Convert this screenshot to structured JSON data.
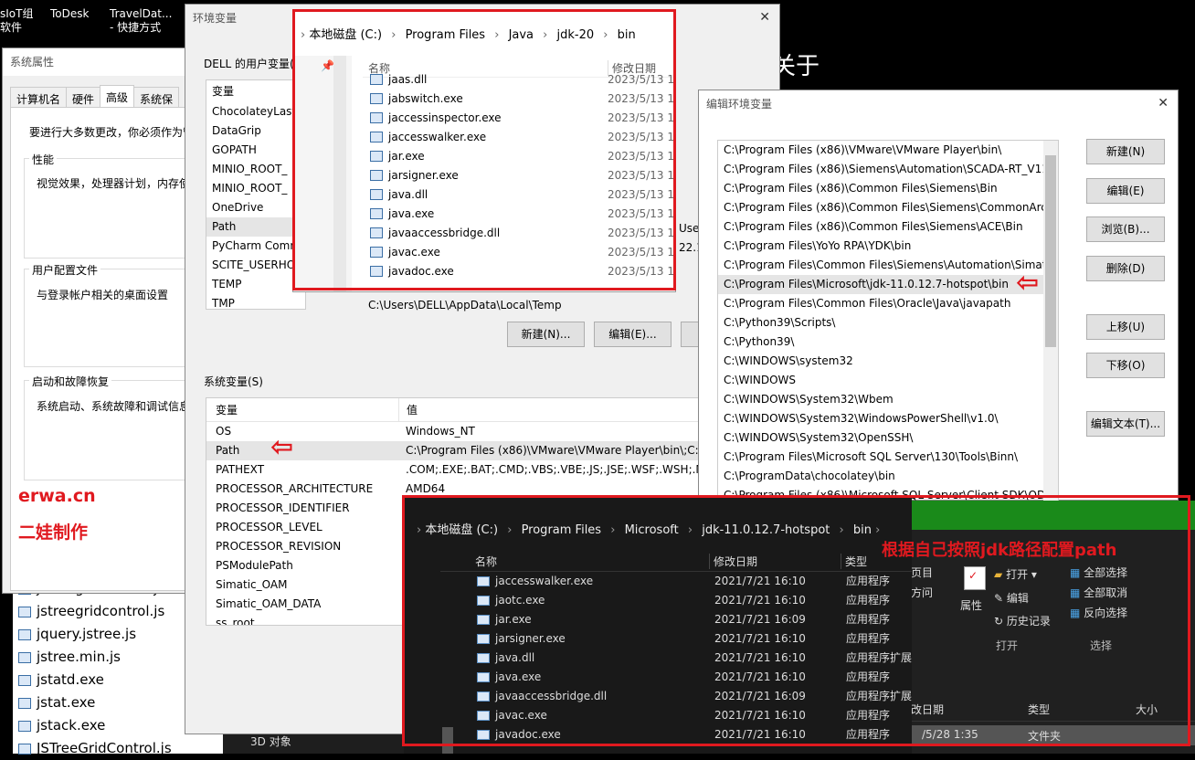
{
  "desktop": {
    "icons": [
      {
        "label": "sIoT组\n软件"
      },
      {
        "label": "ToDesk"
      },
      {
        "label": "TravelDat...\n- 快捷方式"
      }
    ],
    "big_text": "关于",
    "files_left": [
      "jstreegridcontrol.js",
      "jstreegridcontrol.js",
      "jquery.jstree.js",
      "jstree.min.js",
      "jstatd.exe",
      "jstat.exe",
      "jstack.exe",
      "JSTreeGridControl.js"
    ],
    "bottom_item": "3D 对象"
  },
  "sysprops": {
    "title": "系统属性",
    "tabs": [
      "计算机名",
      "硬件",
      "高级",
      "系统保"
    ],
    "admin_note": "要进行大多数更改，你必须作为管",
    "perf_label": "性能",
    "perf_text": "视觉效果，处理器计划，内存使",
    "profile_label": "用户配置文件",
    "profile_text": "与登录帐户相关的桌面设置",
    "startup_label": "启动和故障恢复",
    "startup_text": "系统启动、系统故障和调试信息",
    "watermark1": "erwa.cn",
    "watermark2": "二娃制作"
  },
  "envvars": {
    "title": "环境变量",
    "user_group": "DELL 的用户变量(U",
    "col_var": "变量",
    "col_val": "值",
    "user_vars": [
      "ChocolateyLast",
      "DataGrip",
      "GOPATH",
      "MINIO_ROOT_",
      "MINIO_ROOT_",
      "OneDrive",
      "Path",
      "PyCharm Comm",
      "SCITE_USERHO",
      "TEMP",
      "TMP"
    ],
    "path_val_frag": "Use",
    "pycharm_val_frag": "22.1",
    "tmp_val_frag": "C:\\Users\\DELL\\AppData\\Local\\Temp",
    "btn_new": "新建(N)...",
    "btn_edit": "编辑(E)...",
    "sys_group": "系统变量(S)",
    "sys_vars": [
      {
        "name": "OS",
        "value": "Windows_NT"
      },
      {
        "name": "Path",
        "value": "C:\\Program Files (x86)\\VMware\\VMware Player\\bin\\;C:\\"
      },
      {
        "name": "PATHEXT",
        "value": ".COM;.EXE;.BAT;.CMD;.VBS;.VBE;.JS;.JSE;.WSF;.WSH;.MSC"
      },
      {
        "name": "PROCESSOR_ARCHITECTURE",
        "value": "AMD64"
      },
      {
        "name": "PROCESSOR_IDENTIFIER",
        "value": ""
      },
      {
        "name": "PROCESSOR_LEVEL",
        "value": ""
      },
      {
        "name": "PROCESSOR_REVISION",
        "value": ""
      },
      {
        "name": "PSModulePath",
        "value": ""
      },
      {
        "name": "Simatic_OAM",
        "value": ""
      },
      {
        "name": "Simatic_OAM_DATA",
        "value": ""
      },
      {
        "name": "ss_root",
        "value": ""
      }
    ]
  },
  "explorer_top": {
    "crumbs": [
      "本地磁盘 (C:)",
      "Program Files",
      "Java",
      "jdk-20",
      "bin"
    ],
    "col_name": "名称",
    "col_date": "修改日期",
    "files": [
      {
        "name": "jaas.dll",
        "date": "2023/5/13 1"
      },
      {
        "name": "jabswitch.exe",
        "date": "2023/5/13 1"
      },
      {
        "name": "jaccessinspector.exe",
        "date": "2023/5/13 1"
      },
      {
        "name": "jaccesswalker.exe",
        "date": "2023/5/13 1"
      },
      {
        "name": "jar.exe",
        "date": "2023/5/13 1"
      },
      {
        "name": "jarsigner.exe",
        "date": "2023/5/13 1"
      },
      {
        "name": "java.dll",
        "date": "2023/5/13 1"
      },
      {
        "name": "java.exe",
        "date": "2023/5/13 1"
      },
      {
        "name": "javaaccessbridge.dll",
        "date": "2023/5/13 1"
      },
      {
        "name": "javac.exe",
        "date": "2023/5/13 1"
      },
      {
        "name": "javadoc.exe",
        "date": "2023/5/13 1"
      }
    ]
  },
  "editenv": {
    "title": "编辑环境变量",
    "paths": [
      "C:\\Program Files (x86)\\VMware\\VMware Player\\bin\\",
      "C:\\Program Files (x86)\\Siemens\\Automation\\SCADA-RT_V11\\...",
      "C:\\Program Files (x86)\\Common Files\\Siemens\\Bin",
      "C:\\Program Files (x86)\\Common Files\\Siemens\\CommonArch...",
      "C:\\Program Files (x86)\\Common Files\\Siemens\\ACE\\Bin",
      "C:\\Program Files\\YoYo RPA\\YDK\\bin",
      "C:\\Program Files\\Common Files\\Siemens\\Automation\\Simatic...",
      "C:\\Program Files\\Microsoft\\jdk-11.0.12.7-hotspot\\bin",
      "C:\\Program Files\\Common Files\\Oracle\\Java\\javapath",
      "C:\\Python39\\Scripts\\",
      "C:\\Python39\\",
      "C:\\WINDOWS\\system32",
      "C:\\WINDOWS",
      "C:\\WINDOWS\\System32\\Wbem",
      "C:\\WINDOWS\\System32\\WindowsPowerShell\\v1.0\\",
      "C:\\WINDOWS\\System32\\OpenSSH\\",
      "C:\\Program Files\\Microsoft SQL Server\\130\\Tools\\Binn\\",
      "C:\\ProgramData\\chocolatey\\bin",
      "C:\\Program Files (x86)\\Microsoft SQL Server\\Client SDK\\ODB"
    ],
    "btn_new": "新建(N)",
    "btn_edit": "编辑(E)",
    "btn_browse": "浏览(B)...",
    "btn_delete": "删除(D)",
    "btn_up": "上移(U)",
    "btn_down": "下移(O)",
    "btn_edittext": "编辑文本(T)..."
  },
  "explorer_dark": {
    "crumbs": [
      "本地磁盘 (C:)",
      "Program Files",
      "Microsoft",
      "jdk-11.0.12.7-hotspot",
      "bin"
    ],
    "col_name": "名称",
    "col_date": "修改日期",
    "col_type": "类型",
    "files": [
      {
        "name": "jaccesswalker.exe",
        "date": "2021/7/21 16:10",
        "type": "应用程序"
      },
      {
        "name": "jaotc.exe",
        "date": "2021/7/21 16:10",
        "type": "应用程序"
      },
      {
        "name": "jar.exe",
        "date": "2021/7/21 16:09",
        "type": "应用程序"
      },
      {
        "name": "jarsigner.exe",
        "date": "2021/7/21 16:10",
        "type": "应用程序"
      },
      {
        "name": "java.dll",
        "date": "2021/7/21 16:10",
        "type": "应用程序扩展"
      },
      {
        "name": "java.exe",
        "date": "2021/7/21 16:10",
        "type": "应用程序"
      },
      {
        "name": "javaaccessbridge.dll",
        "date": "2021/7/21 16:09",
        "type": "应用程序扩展"
      },
      {
        "name": "javac.exe",
        "date": "2021/7/21 16:10",
        "type": "应用程序"
      },
      {
        "name": "javadoc.exe",
        "date": "2021/7/21 16:10",
        "type": "应用程序"
      }
    ],
    "annotation": "根据自己按照jdk路径配置path"
  },
  "ribbon": {
    "page_frag": "页目",
    "dir_frag": "方问",
    "props": "属性",
    "open": "打开",
    "edit": "编辑",
    "history": "历史记录",
    "open_group": "打开",
    "select_all": "全部选择",
    "select_none": "全部取消",
    "invert": "反向选择",
    "select_group": "选择",
    "col_date": "改日期",
    "col_type": "类型",
    "col_size": "大小",
    "row_date": "/5/28 1:35",
    "row_type": "文件夹"
  },
  "colors": {
    "annotation_red": "#e0191f",
    "green_bar": "#1a8a1a",
    "selection": "#cce8ff"
  }
}
